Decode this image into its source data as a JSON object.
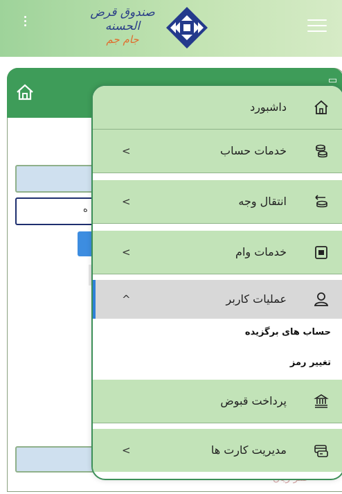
{
  "header": {
    "logo_line1": "صندوق قرض الحسنه",
    "logo_line2": "جام جم",
    "hamburger_icon": "hamburger-menu-icon",
    "kebab_icon": "kebab-menu-icon"
  },
  "background_page": {
    "field_partial_text": "ه",
    "footer_partial_text": "عمر زیان"
  },
  "menu": {
    "items": [
      {
        "label": "داشبورد",
        "icon": "home-icon",
        "chevron": ""
      },
      {
        "label": "خدمات حساب",
        "icon": "coins-stack-icon",
        "chevron": "<"
      },
      {
        "label": "انتقال وجه",
        "icon": "money-transfer-icon",
        "chevron": "<"
      },
      {
        "label": "خدمات وام",
        "icon": "loan-document-icon",
        "chevron": "<"
      },
      {
        "label": "عملیات کاربر",
        "icon": "user-icon",
        "chevron": "^"
      },
      {
        "label": "پرداخت قبوض",
        "icon": "bank-bill-icon",
        "chevron": ""
      },
      {
        "label": "مدیریت کارت ها",
        "icon": "card-management-icon",
        "chevron": "<"
      }
    ],
    "submenu": [
      {
        "label": "حساب های برگزیده"
      },
      {
        "label": "تغییر رمز"
      }
    ]
  },
  "colors": {
    "menu_item_bg": "#c2e3b8",
    "active_item_bg": "#d8d8d8",
    "active_indicator": "#2f80d8",
    "header_green": "#9ed39a",
    "menu_border": "#3c8f58"
  }
}
